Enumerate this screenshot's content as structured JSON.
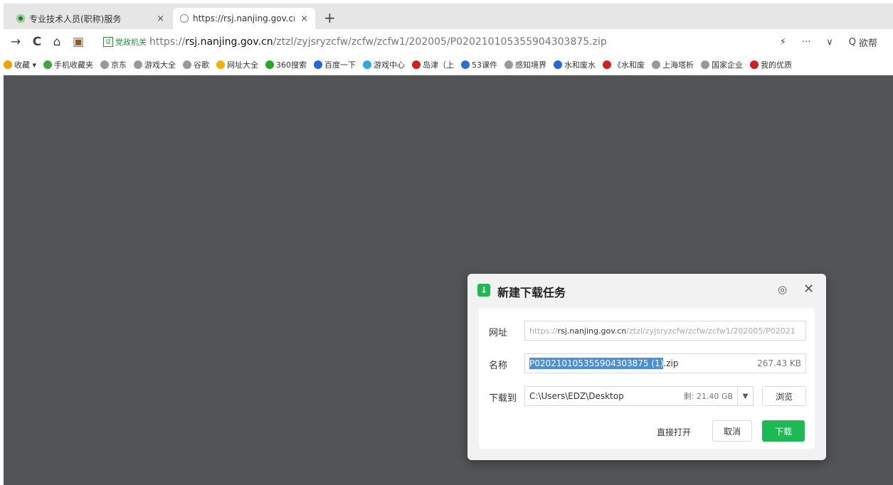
{
  "tabs": [
    {
      "title": "专业技术人员(职称)服务",
      "close": "×",
      "icon": "site-favicon",
      "color": "#2b7a2b"
    },
    {
      "title": "https://rsj.nanjing.gov.cn/zt",
      "close": "×",
      "icon": "globe-favicon",
      "color": "#888888"
    }
  ],
  "new_tab": "+",
  "nav": {
    "back": "→",
    "reload": "C",
    "home": "⌂",
    "ext": "▣"
  },
  "address": {
    "badge": "党政机关",
    "badge_icon": "证",
    "scheme": "https://",
    "host": "rsj.nanjing.gov.cn",
    "path": "/ztzl/zyjsryzcfw/zcfw/zcfw1/202005/P020210105355904303875.zip"
  },
  "toolbar_right": {
    "lightning": "⚡",
    "more": "···",
    "chevron": "∨",
    "search_icon": "Q",
    "search_label": "欲帮"
  },
  "bookmarks": [
    {
      "label": "收藏 ▾",
      "color": "#f0a000"
    },
    {
      "label": "手机收藏夹",
      "color": "#3aa83a"
    },
    {
      "label": "京东",
      "color": "#999999"
    },
    {
      "label": "游戏大全",
      "color": "#999999"
    },
    {
      "label": "谷歌",
      "color": "#999999"
    },
    {
      "label": "网址大全",
      "color": "#f0b400"
    },
    {
      "label": "360搜索",
      "color": "#22a822"
    },
    {
      "label": "百度一下",
      "color": "#2468d8"
    },
    {
      "label": "游戏中心",
      "color": "#2da8e8"
    },
    {
      "label": "岛津（上",
      "color": "#d02020"
    },
    {
      "label": "53课件",
      "color": "#2a70d8"
    },
    {
      "label": "感知境界",
      "color": "#999999"
    },
    {
      "label": "水和废水",
      "color": "#2468d8"
    },
    {
      "label": "《水和废",
      "color": "#d02020"
    },
    {
      "label": "上海塔析",
      "color": "#999999"
    },
    {
      "label": "国家企业",
      "color": "#999999"
    },
    {
      "label": "我的优质",
      "color": "#d02020"
    }
  ],
  "dialog": {
    "title": "新建下载任务",
    "gear": "◎",
    "close": "✕",
    "url_label": "网址",
    "url_scheme": "https://",
    "url_host": "rsj.nanjing.gov.cn",
    "url_path": "/ztzl/zyjsryzcfw/zcfw/zcfw1/202005/P02021",
    "name_label": "名称",
    "name_selected": "P020210105355904303875 (1)",
    "name_ext": ".zip",
    "size": "267.43 KB",
    "save_label": "下载到",
    "path": "C:\\Users\\EDZ\\Desktop",
    "free": "剩: 21.40 GB",
    "drop": "▼",
    "browse": "浏览",
    "open_direct": "直接打开",
    "cancel": "取消",
    "download": "下载",
    "accent": "#1db954"
  }
}
